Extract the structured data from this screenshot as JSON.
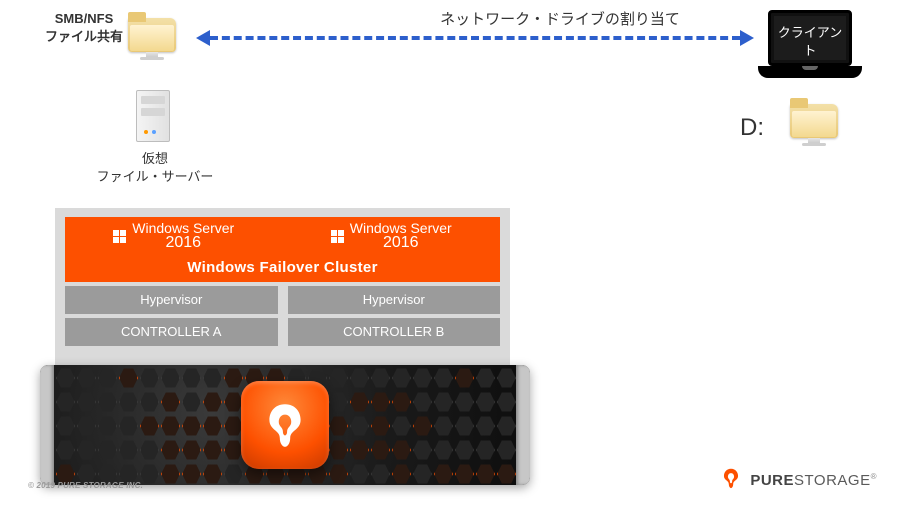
{
  "labels": {
    "smb_nfs": "SMB/NFS\nファイル共有",
    "network_drive": "ネットワーク・ドライブの割り当て",
    "client": "クライアント",
    "virtual_server": "仮想\nファイル・サーバー",
    "drive_letter": "D:",
    "copyright": "© 2019 PURE STORAGE INC."
  },
  "cluster": {
    "ws_left": "Windows Server",
    "ws_left_year": "2016",
    "ws_right": "Windows Server",
    "ws_right_year": "2016",
    "title": "Windows Failover Cluster",
    "hyp_left": "Hypervisor",
    "hyp_right": "Hypervisor",
    "ctrl_left": "CONTROLLER  A",
    "ctrl_right": "CONTROLLER  B"
  },
  "brand": {
    "pure": "PURE",
    "storage": "STORAGE"
  }
}
